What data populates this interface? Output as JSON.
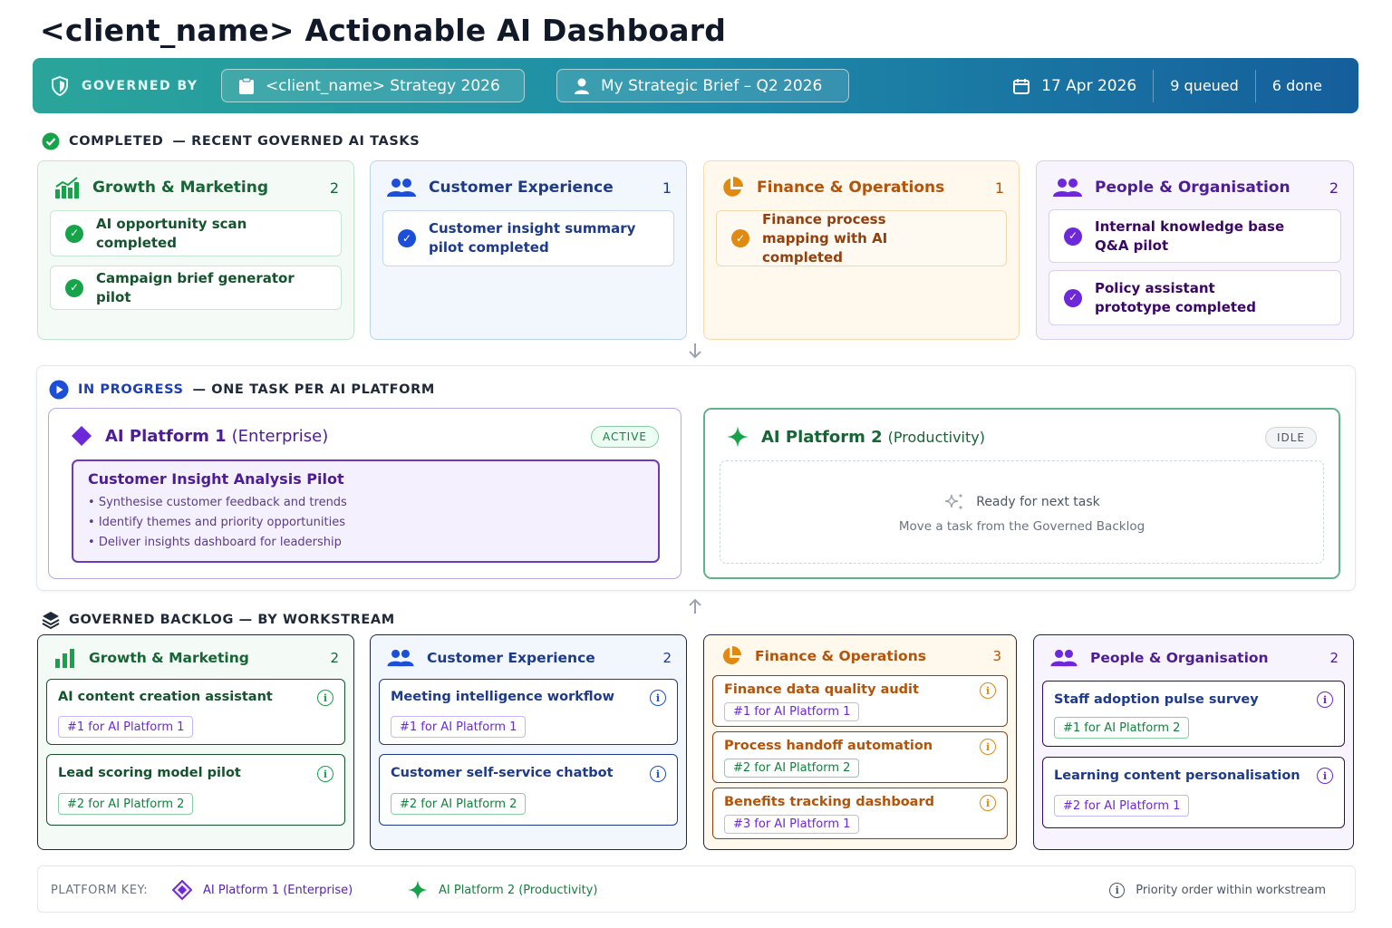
{
  "title": "<client_name> Actionable AI Dashboard",
  "header": {
    "governed_by": "GOVERNED BY",
    "strategy": "<client_name> Strategy 2026",
    "brief": "My Strategic Brief – Q2 2026",
    "date": "17 Apr 2026",
    "queued": "9 queued",
    "done": "6 done"
  },
  "completed": {
    "label_strong": "COMPLETED",
    "label_rest": "— RECENT GOVERNED AI TASKS",
    "columns": [
      {
        "title": "Growth & Marketing",
        "count": "2",
        "icon": "chart-bar-icon",
        "items": [
          "AI opportunity scan completed",
          "Campaign brief generator pilot"
        ]
      },
      {
        "title": "Customer Experience",
        "count": "1",
        "icon": "users-icon",
        "items": [
          "Customer insight summary pilot completed"
        ]
      },
      {
        "title": "Finance & Operations",
        "count": "1",
        "icon": "pie-chart-icon",
        "items": [
          "Finance process mapping with AI completed"
        ]
      },
      {
        "title": "People & Organisation",
        "count": "2",
        "icon": "users-icon",
        "items": [
          "Internal knowledge base Q&A pilot",
          "Policy assistant prototype completed"
        ]
      }
    ]
  },
  "in_progress": {
    "label_strong": "IN PROGRESS",
    "label_rest": "— ONE TASK PER AI PLATFORM",
    "platform1": {
      "name": "AI Platform 1",
      "sub": "(Enterprise)",
      "status": "ACTIVE",
      "task_title": "Customer Insight Analysis Pilot",
      "bullets": [
        "Synthesise customer feedback and trends",
        "Identify themes and priority opportunities",
        "Deliver insights dashboard for leadership"
      ]
    },
    "platform2": {
      "name": "AI Platform 2",
      "sub": "(Productivity)",
      "status": "IDLE",
      "ready": "Ready for next task",
      "hint": "Move a task from the Governed Backlog"
    }
  },
  "backlog": {
    "label": "GOVERNED BACKLOG — BY WORKSTREAM",
    "columns": [
      {
        "title": "Growth & Marketing",
        "count": "2",
        "items": [
          {
            "title": "AI content creation assistant",
            "tag": "#1 for AI Platform 1"
          },
          {
            "title": "Lead scoring model pilot",
            "tag": "#2 for AI Platform 2"
          }
        ]
      },
      {
        "title": "Customer Experience",
        "count": "2",
        "items": [
          {
            "title": "Meeting intelligence workflow",
            "tag": "#1 for AI Platform 1"
          },
          {
            "title": "Customer self-service chatbot",
            "tag": "#2 for AI Platform 2"
          }
        ]
      },
      {
        "title": "Finance & Operations",
        "count": "3",
        "items": [
          {
            "title": "Finance data quality audit",
            "tag": "#1 for AI Platform 1"
          },
          {
            "title": "Process handoff automation",
            "tag": "#2 for AI Platform 2"
          },
          {
            "title": "Benefits tracking dashboard",
            "tag": "#3 for AI Platform 1"
          }
        ]
      },
      {
        "title": "People & Organisation",
        "count": "2",
        "items": [
          {
            "title": "Staff adoption pulse survey",
            "tag": "#1 for AI Platform 2"
          },
          {
            "title": "Learning content personalisation",
            "tag": "#2 for AI Platform 1"
          }
        ]
      }
    ]
  },
  "key": {
    "label": "PLATFORM KEY:",
    "p1": "AI Platform 1 (Enterprise)",
    "p2": "AI Platform 2 (Productivity)",
    "priority": "Priority order within workstream"
  },
  "colors": {
    "platform1": "#6d28d9",
    "platform2": "#16a34a",
    "header_start": "#2aa59a",
    "header_end": "#155e9c"
  }
}
